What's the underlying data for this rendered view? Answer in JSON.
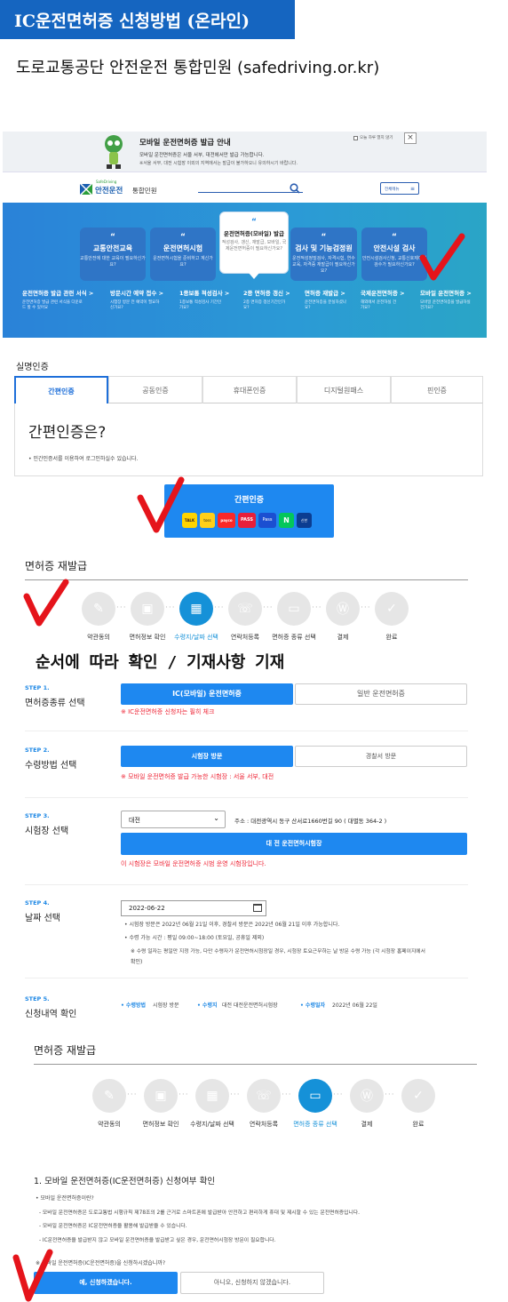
{
  "header": {
    "title": "IC운전면허증 신청방법 (온라인)",
    "subtitle": "도로교통공단 안전운전 통합민원 (safedriving.or.kr)"
  },
  "banner": {
    "title": "모바일 운전면허증 발급 안내",
    "line1": "모바일 운전면허증은 서울 서부, 대전에서만 발급 가능합니다.",
    "line2": "※서울 서부, 대전 시험장 이외의 지역에서는 발급이 불가하오니 유의하시기 바랍니다.",
    "close_label": "오늘 하루 열지 않기"
  },
  "site": {
    "logo_small": "SafeDriving",
    "logo": "안전운전",
    "logo_suffix": "통합민원",
    "menu_label": "전체메뉴"
  },
  "hero": {
    "cards": [
      {
        "title": "교통안전교육",
        "sub": "교통안전에 대한 교육이 필요하신가요?"
      },
      {
        "title": "운전면허시험",
        "sub": "운전면허시험을 준비하고 계신가요?"
      },
      {
        "title": "운전면허증(모바일) 발급",
        "sub": "적성검사, 갱신, 재발급, 모바일, 국제운전면허증이 필요하신가요?"
      },
      {
        "title": "검사 및 기능검정원",
        "sub": "운전적성정밀검사, 자격시험, 연수교육, 자격증 재발급이 필요하신가요?"
      },
      {
        "title": "안전시설 검사",
        "sub": "안전시설검사신청, 교통신호제어기 검수가 필요하신가요?"
      }
    ],
    "links": [
      {
        "label": "운전면허증 발급 관련 서식 >",
        "sub": "운전면허증 발급 관련 서식을 다운로드 할 수 있어요"
      },
      {
        "label": "방문시간 예약 접수 >",
        "sub": "시험장 방문 전 예약이 필요하신가요?"
      },
      {
        "label": "1종보통 적성검사 >",
        "sub": "1종보통 적성검사 기간인가요?"
      },
      {
        "label": "2종 면허증 갱신 >",
        "sub": "2종 면허증 갱신기간인가요?"
      },
      {
        "label": "면허증 재발급 >",
        "sub": "운전면허증을 분실하셨나요?"
      },
      {
        "label": "국제운전면허증 >",
        "sub": "해외에서 운전하실 건가요?"
      },
      {
        "label": "모바일 운전면허증 >",
        "sub": "모바일 운전면허증을 발급하실 건가요?"
      }
    ]
  },
  "auth": {
    "section_title": "실명인증",
    "tabs": [
      "간편인증",
      "공동인증",
      "휴대폰인증",
      "디지털원패스",
      "핀인증"
    ],
    "heading": "간편인증은?",
    "desc": "• 민간인증서를 이용하여 로그인하실수 있습니다.",
    "button_label": "간편인증",
    "providers": [
      "TALK",
      "toss",
      "payco",
      "PASS",
      "Pass",
      "N",
      "신한"
    ]
  },
  "reissue1": {
    "title": "면허증 재발급",
    "steps": [
      "약관동의",
      "면허정보 확인",
      "수령지/날짜 선택",
      "연락처등록",
      "면허증 종류 선택",
      "결제",
      "완료"
    ],
    "active": 2
  },
  "caption": "순서에 따라 확인 / 기재사항 기재",
  "form": {
    "step1": {
      "num": "STEP 1.",
      "title": "면허증종류 선택",
      "opt_a": "IC(모바일) 운전면허증",
      "opt_b": "일반 운전면허증",
      "note": "※ IC운전면허증 신청자는 필히 체크"
    },
    "step2": {
      "num": "STEP 2.",
      "title": "수령방법 선택",
      "opt_a": "시험장 방문",
      "opt_b": "경찰서 방문",
      "note": "※ 모바일 운전면허증 발급 가능한 시험장 : 서울 서부, 대전"
    },
    "step3": {
      "num": "STEP 3.",
      "title": "시험장 선택",
      "select_value": "대전",
      "address": "주소 : 대전광역시 동구 산서로1660번길 90 ( 대별동 364-2 )",
      "button": "대 전 운전면허시험장",
      "note": "이 시험장은 모바일 운전면허증 시범 운영 시험장입니다."
    },
    "step4": {
      "num": "STEP 4.",
      "title": "날짜 선택",
      "date": "2022-06-22",
      "info1": "• 시험장 방문은 2022년 06월 21일 이후, 경찰서 방문은 2022년 06월 21일 이후 가능합니다.",
      "info2": "• 수령 가능 시간 : 평일 09:00~18:00 (토요일, 공휴일 제외)",
      "info3": "※ 수령 일자는 평일만 지정 가능, 다만 수령자가 운전면허시험장일 경우, 시험장 토요근무하는 날 방문 수령 가능 (각 시험장 홈페이지에서",
      "info4": "확인)"
    },
    "step5": {
      "num": "STEP 5.",
      "title": "신청내역 확인",
      "k1": "• 수령방법",
      "v1": "시험장 방문",
      "k2": "• 수령지",
      "v2": "대전 대전운전면허시험장",
      "k3": "• 수령일자",
      "v3": "2022년 06월 22일"
    }
  },
  "reissue2": {
    "title": "면허증 재발급",
    "steps": [
      "약관동의",
      "면허정보 확인",
      "수령지/날짜 선택",
      "연락처등록",
      "면허증 종류 선택",
      "결제",
      "완료"
    ],
    "active": 4
  },
  "confirm": {
    "heading": "1. 모바일 운전면허증(IC운전면허증) 신청여부 확인",
    "q": "• 모바일 운전면허증이란?",
    "l1": "- 모바일 운전면허증은 도로교통법 시행규칙 제78조의 2를 근거로 스마트폰에 발급받아 안전하고 편리하게 휴대 및 제시할 수 있는 운전면허증입니다.",
    "l2": "- 모바일 운전면허증은 IC운전면허증을 활용해 발급받을 수 있습니다.",
    "l3": "- IC운전면허증을 발급받지 않고 모바일 운전면허증을 발급받고 싶은 경우, 운전면허시험장 방문이 필요합니다.",
    "ask": "※ 모바일 운전면허증(IC운전면허증)을 신청하시겠습니까?",
    "yes": "예, 신청하겠습니다.",
    "no": "아니오, 신청하지 않겠습니다."
  }
}
